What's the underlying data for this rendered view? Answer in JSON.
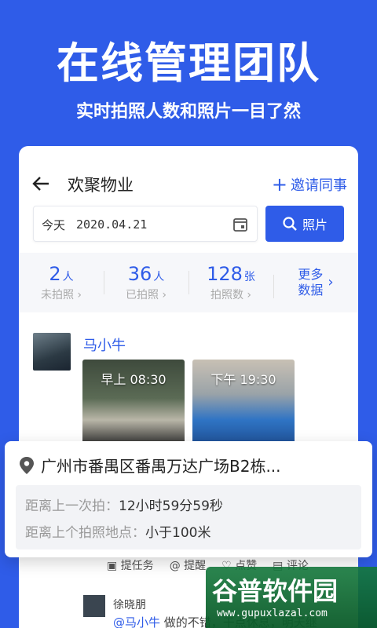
{
  "hero": {
    "title": "在线管理团队",
    "subtitle": "实时拍照人数和照片一目了然"
  },
  "header": {
    "title": "欢聚物业",
    "invite_label": "邀请同事"
  },
  "filter": {
    "date_label": "今天",
    "date_value": "2020.04.21",
    "photo_button": "照片"
  },
  "stats": [
    {
      "value": "2",
      "unit": "人",
      "label": "未拍照"
    },
    {
      "value": "36",
      "unit": "人",
      "label": "已拍照"
    },
    {
      "value": "128",
      "unit": "张",
      "label": "拍照数"
    }
  ],
  "more_data": {
    "line1": "更多",
    "line2": "数据"
  },
  "feed": {
    "user_name": "马小牛",
    "photos": [
      {
        "time_label": "早上 08:30"
      },
      {
        "time_label": "下午 19:30"
      }
    ],
    "actions": [
      "提任务",
      "提醒",
      "点赞",
      "评论"
    ]
  },
  "popup": {
    "location": "广州市番禺区番禺万达广场B2栋...",
    "last_shot_key": "距离上一次拍：",
    "last_shot_value": "12小时59分59秒",
    "last_place_key": "距离上个拍照地点：",
    "last_place_value": "小于100米"
  },
  "comment": {
    "user": "徐晓朋",
    "mention": "@马小牛",
    "text": "做的不错，干点休息，明天继"
  },
  "watermark": {
    "brand": "谷普软件园",
    "url": "www.gupuxlazal.com"
  },
  "colors": {
    "accent": "#2f5ce8",
    "background": "#2f5ce8"
  }
}
